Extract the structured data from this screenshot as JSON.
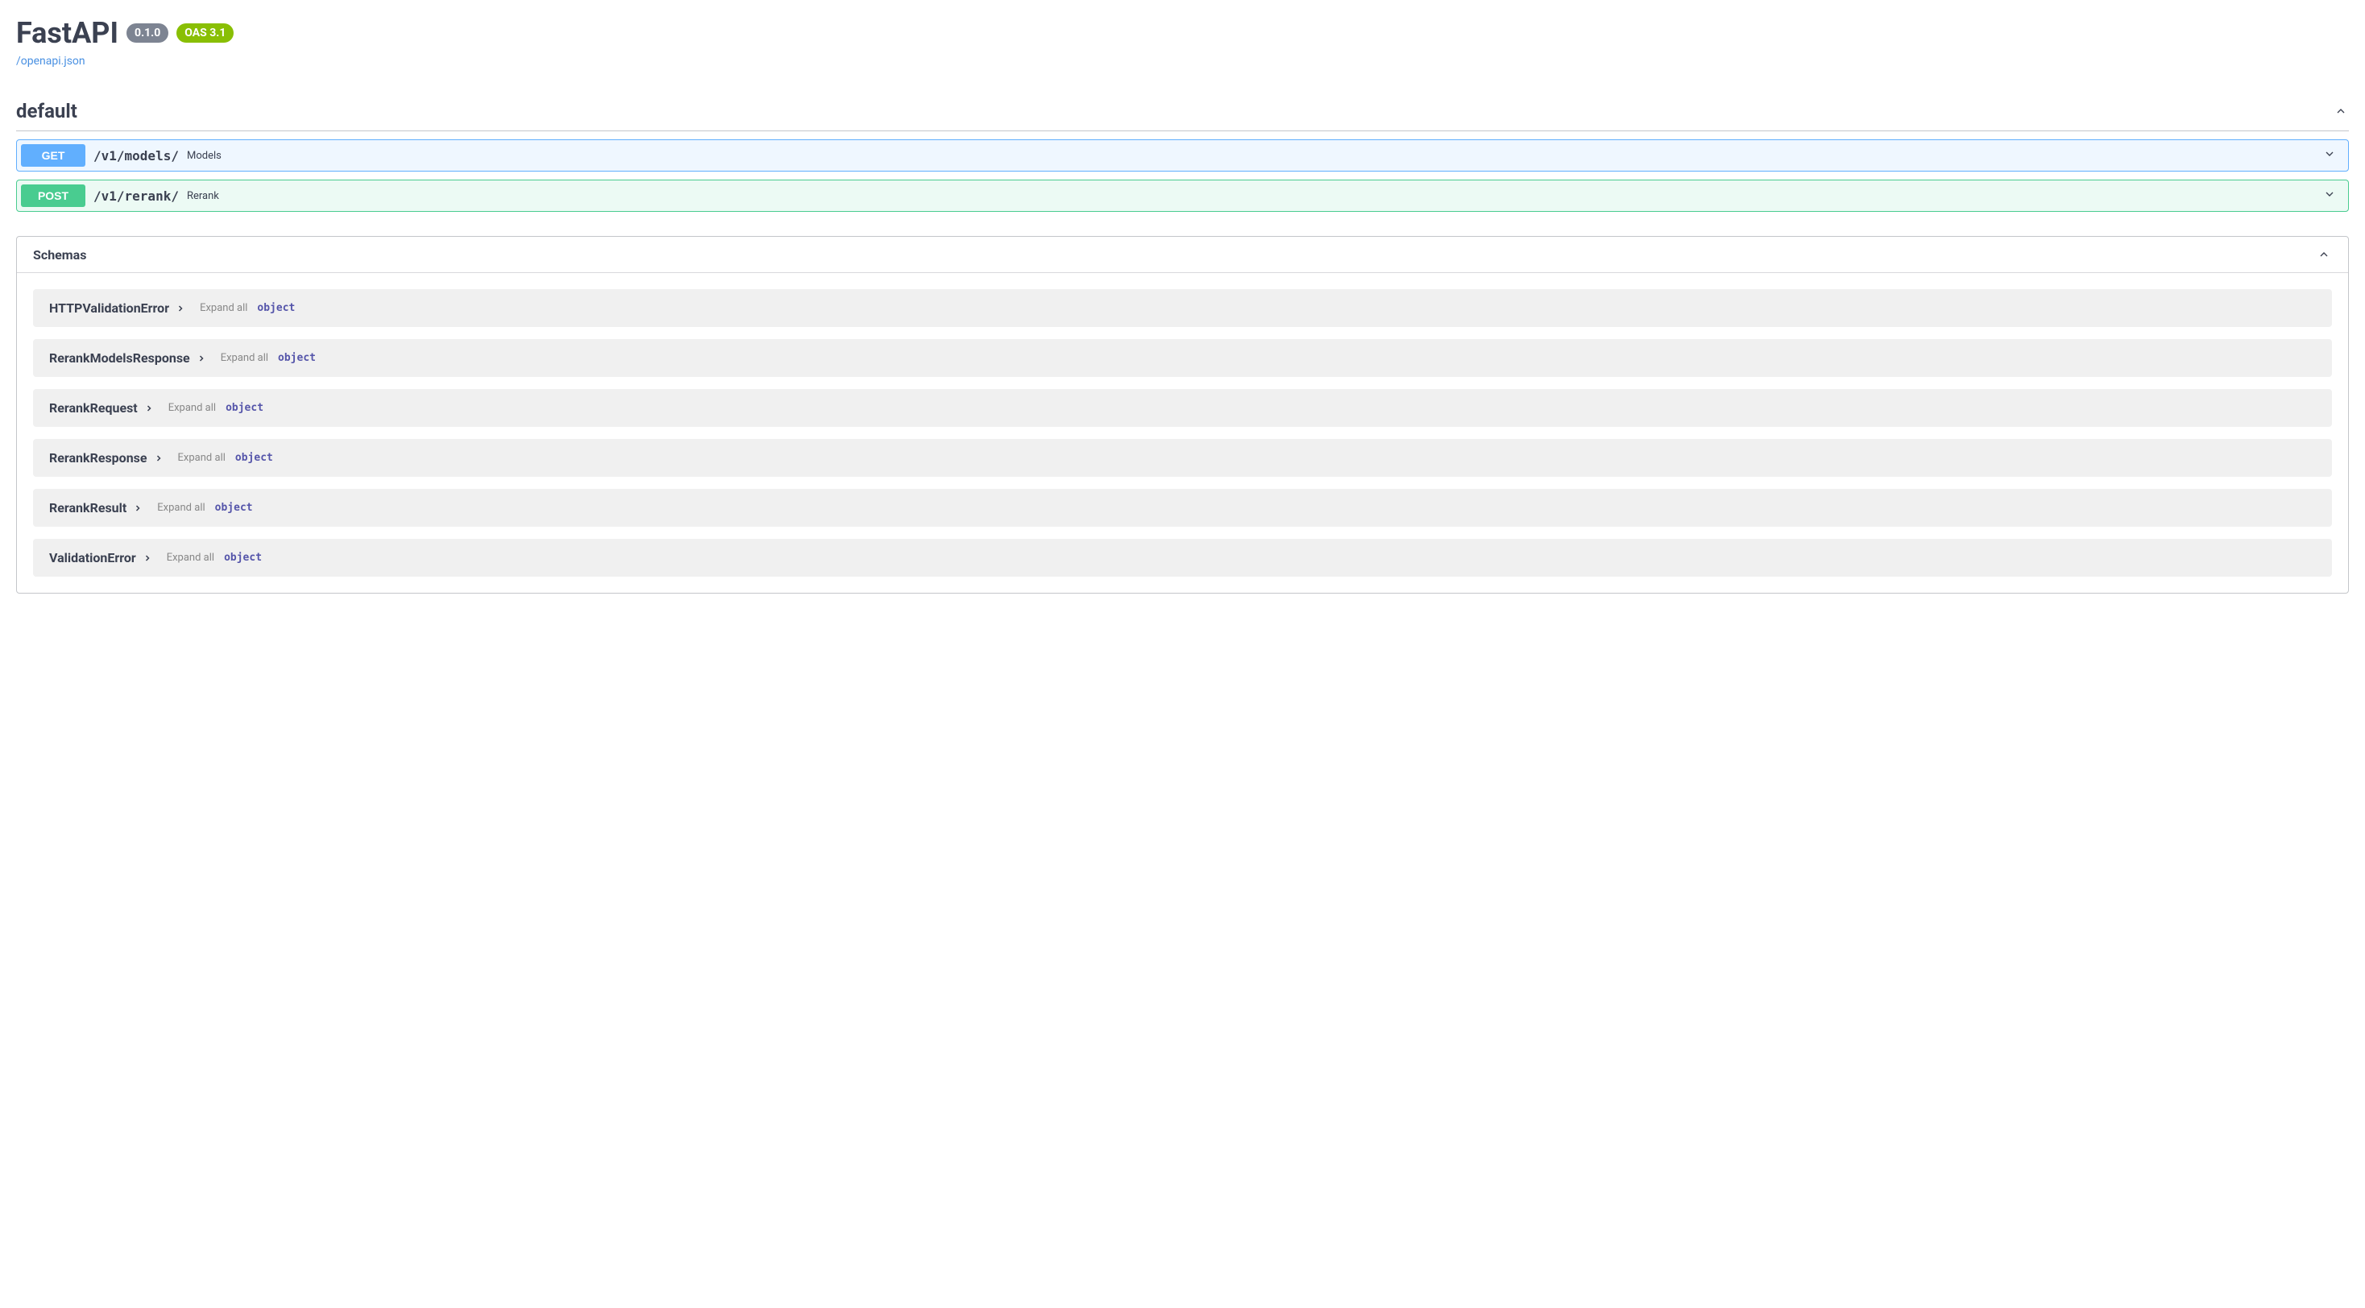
{
  "header": {
    "title": "FastAPI",
    "version": "0.1.0",
    "oas_version": "OAS 3.1",
    "openapi_link": "/openapi.json"
  },
  "sections": {
    "default": {
      "title": "default",
      "endpoints": [
        {
          "method": "GET",
          "path": "/v1/models/",
          "desc": "Models"
        },
        {
          "method": "POST",
          "path": "/v1/rerank/",
          "desc": "Rerank"
        }
      ]
    }
  },
  "schemas": {
    "title": "Schemas",
    "expand_label": "Expand all",
    "type_label": "object",
    "items": [
      {
        "name": "HTTPValidationError"
      },
      {
        "name": "RerankModelsResponse"
      },
      {
        "name": "RerankRequest"
      },
      {
        "name": "RerankResponse"
      },
      {
        "name": "RerankResult"
      },
      {
        "name": "ValidationError"
      }
    ]
  }
}
